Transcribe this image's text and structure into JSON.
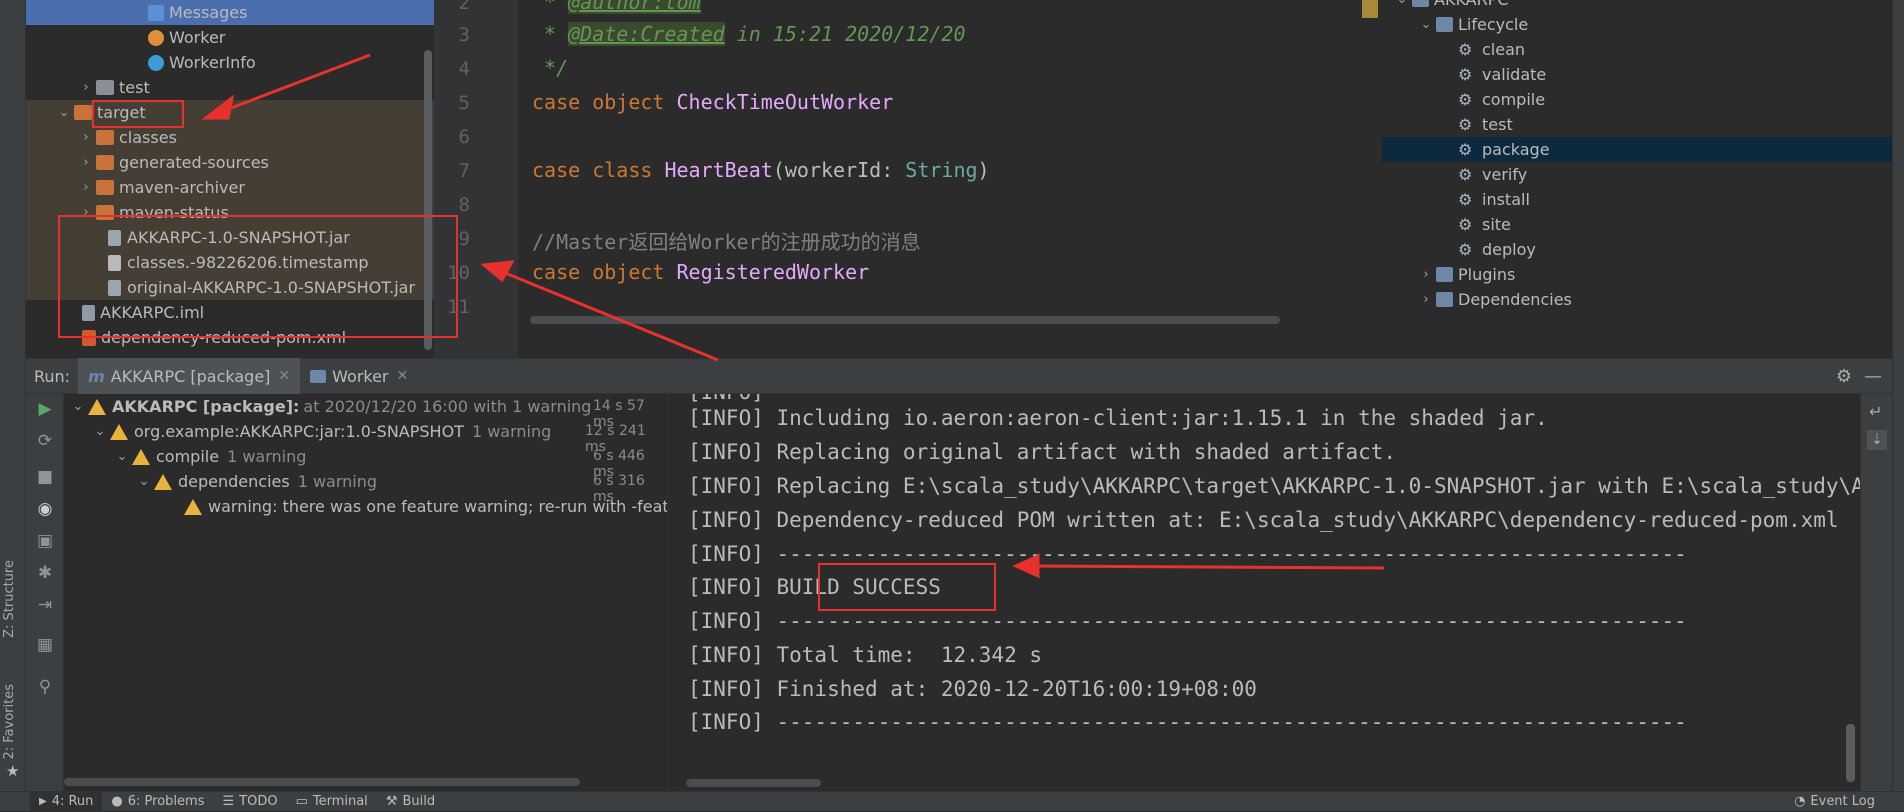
{
  "left_stripe": {
    "structure_tab": "Z: Structure",
    "favorites_tab": "2: Favorites"
  },
  "project_tree": {
    "items": [
      {
        "label": "Messages"
      },
      {
        "label": "Worker"
      },
      {
        "label": "WorkerInfo"
      },
      {
        "label": "test"
      },
      {
        "label": "target"
      },
      {
        "label": "classes"
      },
      {
        "label": "generated-sources"
      },
      {
        "label": "maven-archiver"
      },
      {
        "label": "maven-status"
      },
      {
        "label": "AKKARPC-1.0-SNAPSHOT.jar"
      },
      {
        "label": "classes.-98226206.timestamp"
      },
      {
        "label": "original-AKKARPC-1.0-SNAPSHOT.jar"
      },
      {
        "label": "AKKARPC.iml"
      },
      {
        "label": "dependency-reduced-pom.xml"
      }
    ]
  },
  "editor": {
    "line_numbers": [
      "2",
      "3",
      "4",
      "5",
      "6",
      "7",
      "8",
      "9",
      "10",
      "11"
    ],
    "lines": {
      "l2_tag": "@author:tom",
      "l3_star": " * ",
      "l3_tag": "@Date:Created",
      "l3_rest": " in 15:21 2020/12/20",
      "l4": " */",
      "l5_kw": "case object ",
      "l5_name": "CheckTimeOutWorker",
      "l7_kw": "case class ",
      "l7_name": "HeartBeat",
      "l7_param": "(workerId: ",
      "l7_type": "String",
      "l7_close": ")",
      "l9_comment": "//Master返回给Worker的注册成功的消息",
      "l10_kw": "case object ",
      "l10_name": "RegisteredWorker"
    }
  },
  "maven": {
    "root": "AKKARPC",
    "lifecycle": "Lifecycle",
    "phases": [
      "clean",
      "validate",
      "compile",
      "test",
      "package",
      "verify",
      "install",
      "site",
      "deploy"
    ],
    "plugins": "Plugins",
    "dependencies": "Dependencies"
  },
  "run_bar": {
    "label": "Run:",
    "tabs": [
      {
        "label": "AKKARPC [package]"
      },
      {
        "label": "Worker"
      }
    ]
  },
  "build_tree": {
    "rows": [
      {
        "label": "AKKARPC [package]:",
        "detail": "at 2020/12/20 16:00 with 1 warning",
        "time": "14 s 57 ms"
      },
      {
        "label": "org.example:AKKARPC:jar:1.0-SNAPSHOT",
        "detail": "1 warning",
        "time": "12 s 241 ms"
      },
      {
        "label": "compile",
        "detail": "1 warning",
        "time": "6 s 446 ms"
      },
      {
        "label": "dependencies",
        "detail": "1 warning",
        "time": "6 s 316 ms"
      },
      {
        "label": "warning: there was one feature warning; re-run with -feature for details"
      }
    ]
  },
  "console": {
    "lines": [
      "[INFO] Including io.aeron:aeron-client:jar:1.15.1 in the shaded jar.",
      "[INFO] Replacing original artifact with shaded artifact.",
      "[INFO] Replacing E:\\scala_study\\AKKARPC\\target\\AKKARPC-1.0-SNAPSHOT.jar with E:\\scala_study\\AKKARPC\\target\\AKKARPC-1.0-SNAPSHOT-shaded.jar",
      "[INFO] Dependency-reduced POM written at: E:\\scala_study\\AKKARPC\\dependency-reduced-pom.xml",
      "[INFO] ------------------------------------------------------------------------",
      "[INFO] BUILD SUCCESS",
      "[INFO] ------------------------------------------------------------------------",
      "[INFO] Total time:  12.342 s",
      "[INFO] Finished at: 2020-12-20T16:00:19+08:00",
      "[INFO] ------------------------------------------------------------------------"
    ]
  },
  "status_bar": {
    "items": [
      {
        "label": "4: Run"
      },
      {
        "label": "6: Problems"
      },
      {
        "label": "TODO"
      },
      {
        "label": "Terminal"
      },
      {
        "label": "Build"
      },
      {
        "label": "Event Log"
      }
    ]
  },
  "colors": {
    "annotation_red": "#e8312f",
    "selection_blue": "#4b6eaf",
    "keyword_orange": "#cc7832",
    "warning_yellow": "#e8b33b"
  }
}
